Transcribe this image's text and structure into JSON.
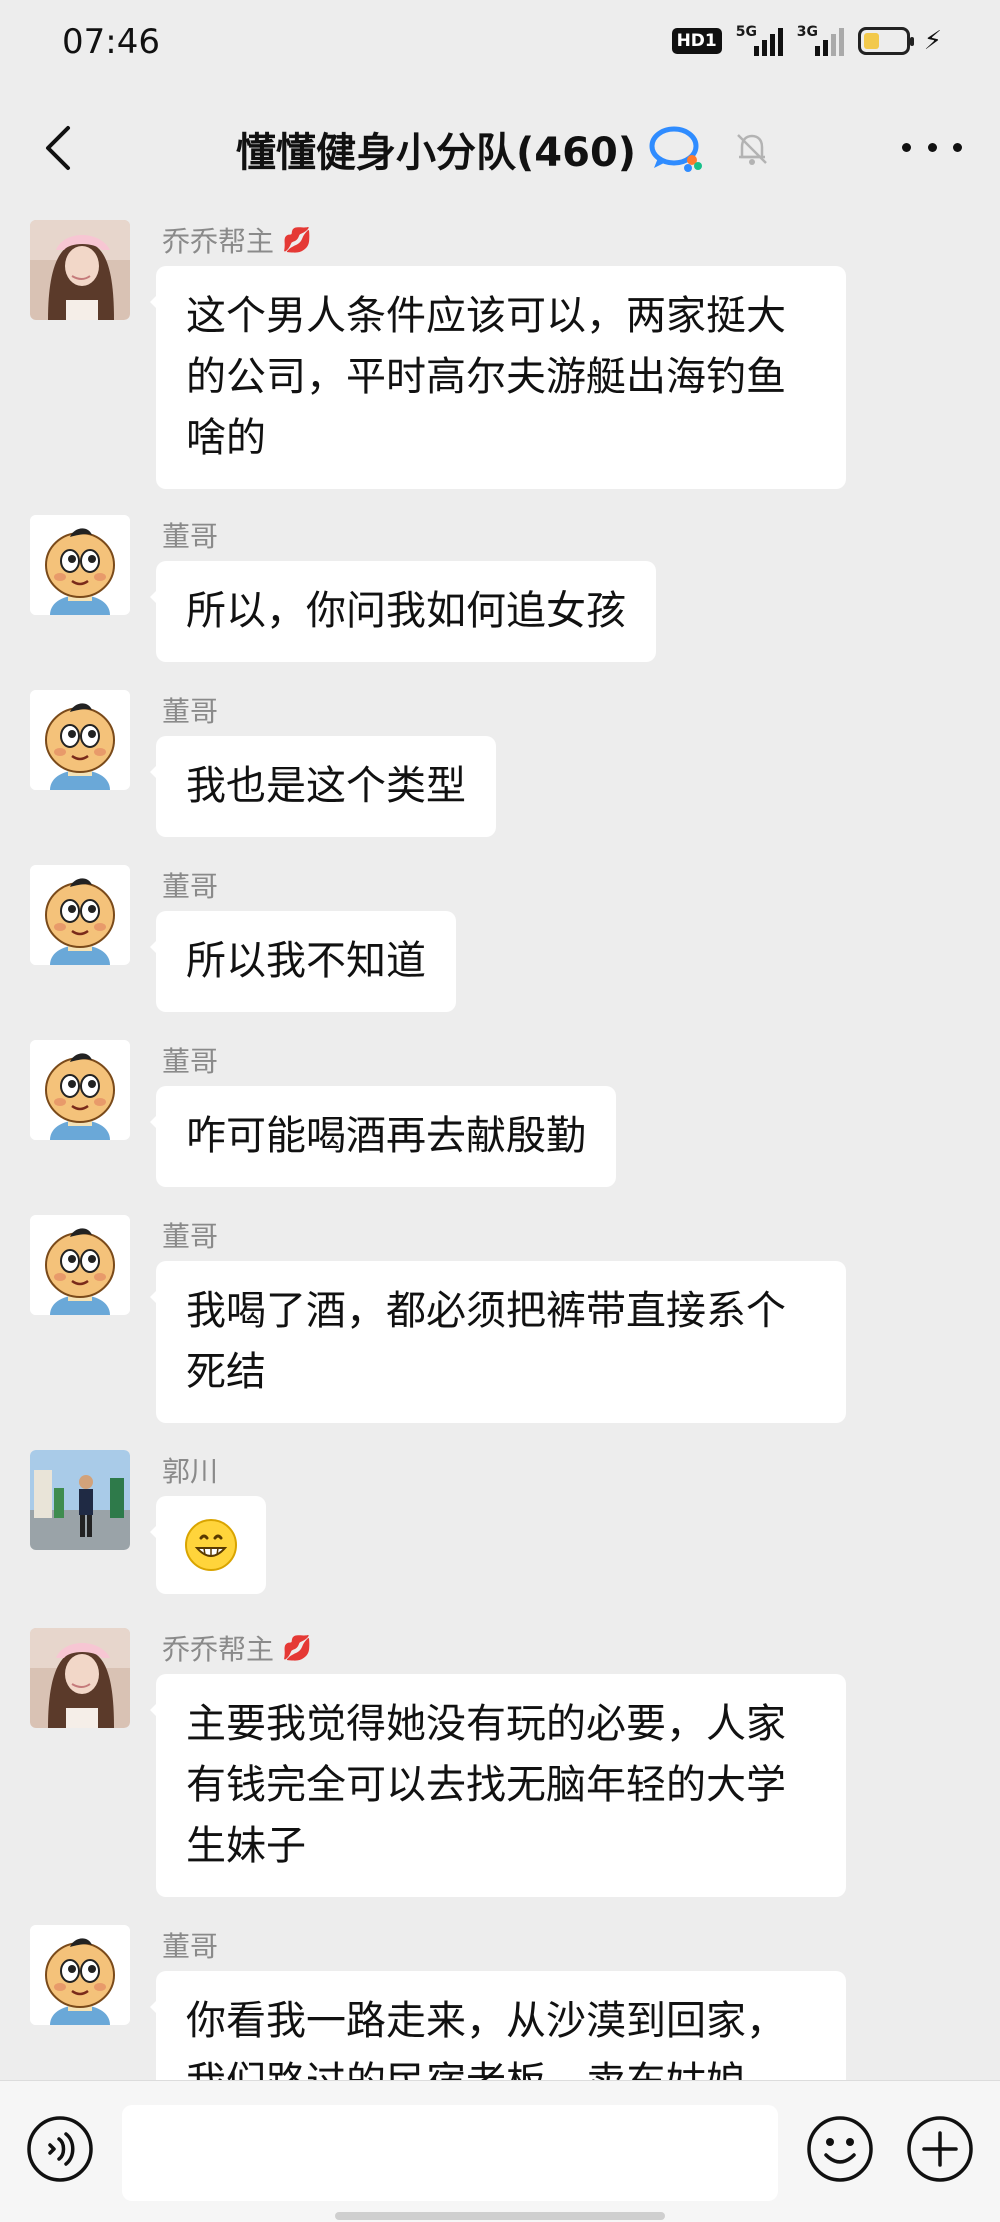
{
  "status": {
    "time": "07:46",
    "hd_badge": "HD1",
    "sim1_label": "5G",
    "sim2_label": "3G",
    "battery_level": 0.34
  },
  "header": {
    "title": "懂懂健身小分队(460)",
    "icons": {
      "back": "back-chevron-icon",
      "group_badge": "chat-bubble-icon",
      "mute": "bell-muted-icon",
      "more": "more-dots-icon"
    }
  },
  "messages": [
    {
      "sender": "乔乔帮主",
      "sender_emoji": "💋",
      "avatar": "woman-photo",
      "text": "这个男人条件应该可以，两家挺大的公司，平时高尔夫游艇出海钓鱼啥的"
    },
    {
      "sender": "董哥",
      "avatar": "cartoon-baby",
      "text": "所以，你问我如何追女孩"
    },
    {
      "sender": "董哥",
      "avatar": "cartoon-baby",
      "text": "我也是这个类型"
    },
    {
      "sender": "董哥",
      "avatar": "cartoon-baby",
      "text": "所以我不知道"
    },
    {
      "sender": "董哥",
      "avatar": "cartoon-baby",
      "text": "咋可能喝酒再去献殷勤"
    },
    {
      "sender": "董哥",
      "avatar": "cartoon-baby",
      "text": "我喝了酒，都必须把裤带直接系个死结"
    },
    {
      "sender": "郭川",
      "avatar": "man-outdoor-photo",
      "text": "",
      "emoji": "grinning-face"
    },
    {
      "sender": "乔乔帮主",
      "sender_emoji": "💋",
      "avatar": "woman-photo",
      "text": "主要我觉得她没有玩的必要，人家有钱完全可以去找无脑年轻的大学生妹子"
    },
    {
      "sender": "董哥",
      "avatar": "cartoon-baby",
      "text": "你看我一路走来，从沙漠到回家，我们路过的民宿老板，卖东姑娘"
    }
  ],
  "input": {
    "placeholder": "",
    "icons": {
      "voice": "voice-icon",
      "emoji": "emoji-icon",
      "plus": "plus-icon"
    }
  }
}
